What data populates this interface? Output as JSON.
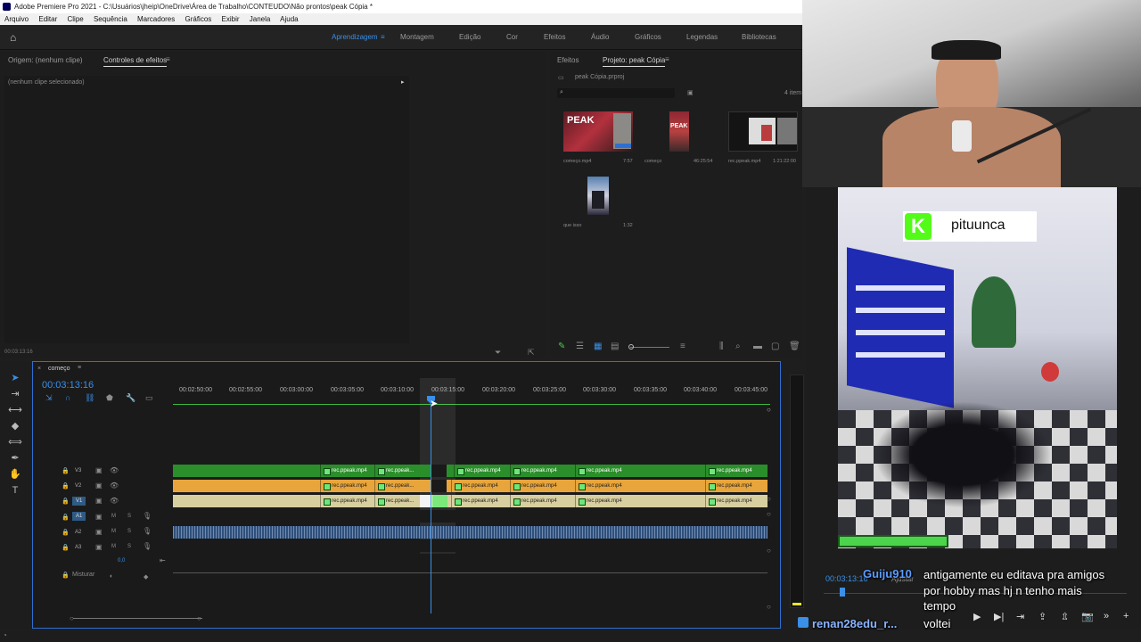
{
  "window": {
    "title": "Adobe Premiere Pro 2021 - C:\\Usuários\\jheip\\OneDrive\\Área de Trabalho\\CONTEUDO\\Não prontos\\peak Cópia *"
  },
  "menu": [
    "Arquivo",
    "Editar",
    "Clipe",
    "Sequência",
    "Marcadores",
    "Gráficos",
    "Exibir",
    "Janela",
    "Ajuda"
  ],
  "workspaces": [
    "Aprendizagem",
    "Montagem",
    "Edição",
    "Cor",
    "Efeitos",
    "Áudio",
    "Gráficos",
    "Legendas",
    "Bibliotecas"
  ],
  "source_panel": {
    "tab_origin": "Origem: (nenhum clipe)",
    "tab_effects": "Controles de efeitos",
    "empty_msg": "(nenhum clipe selecionado)",
    "timecode": "00:03:13:16"
  },
  "project_panel": {
    "tab_effects": "Efeitos",
    "tab_project": "Projeto: peak Cópia",
    "file": "peak Cópia.prproj",
    "count": "4 item",
    "items": [
      {
        "name": "começo.mp4",
        "duration": "7:57"
      },
      {
        "name": "começo",
        "duration": "46:25:54"
      },
      {
        "name": "rec.ppeak.mp4",
        "duration": "1:21:22:00"
      },
      {
        "name": "que isso",
        "duration": "1:32"
      }
    ]
  },
  "timeline": {
    "sequence_name": "começo",
    "timecode": "00:03:13:16",
    "ruler": [
      "00:02:50:00",
      "00:02:55:00",
      "00:03:00:00",
      "00:03:05:00",
      "00:03:10:00",
      "00:03:15:00",
      "00:03:20:00",
      "00:03:25:00",
      "00:03:30:00",
      "00:03:35:00",
      "00:03:40:00",
      "00:03:45:00"
    ],
    "video_tracks": [
      "V3",
      "V2",
      "V1"
    ],
    "audio_tracks": [
      "A1",
      "A2",
      "A3"
    ],
    "mix_label": "Misturar",
    "mix_value": "0,0",
    "clip_label": "rec.ppeak.mp4",
    "clip_label_short": "rec.ppeak..."
  },
  "overlay": {
    "logo_letter": "K",
    "streamer": "pituunca",
    "program_timecode": "00:03:13:16",
    "program_fit": "Ajustar",
    "chat": [
      {
        "user": "Guiju910",
        "lines": [
          "antigamente eu editava pra amigos",
          "por hobby mas hj n tenho mais",
          "tempo"
        ]
      },
      {
        "user": "renan28edu_r...",
        "lines": [
          "voltei"
        ]
      }
    ]
  },
  "colors": {
    "accent": "#3a8fe7",
    "v3": "#2a8f2a",
    "v2": "#e8a53b",
    "v1": "#d8cfa0",
    "audio": "#2e4f7a",
    "kick": "#53fc18"
  }
}
